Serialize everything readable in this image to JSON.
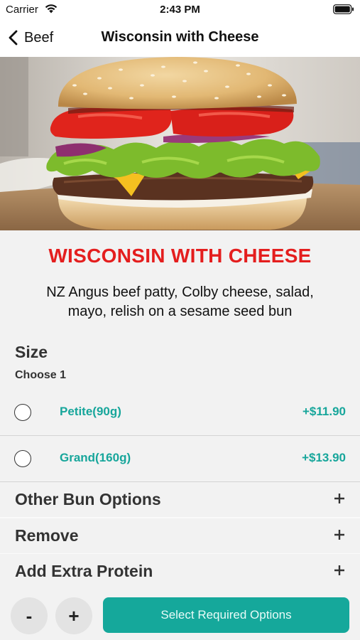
{
  "status_bar": {
    "carrier": "Carrier",
    "time": "2:43 PM",
    "icons": [
      "wifi-icon",
      "battery-icon"
    ]
  },
  "nav": {
    "back_label": "Beef",
    "back_icon": "chevron-left-icon",
    "title": "Wisconsin with Cheese"
  },
  "hero": {
    "image": "burger-photo"
  },
  "item": {
    "title": "WISCONSIN WITH CHEESE",
    "description": "NZ Angus beef patty, Colby cheese, salad, mayo, relish on a sesame seed bun"
  },
  "size": {
    "heading": "Size",
    "subheading": "Choose 1",
    "options": [
      {
        "name": "Petite(90g)",
        "price": "+$11.90",
        "selected": false
      },
      {
        "name": "Grand(160g)",
        "price": "+$13.90",
        "selected": false
      }
    ]
  },
  "sections": [
    {
      "label": "Other Bun Options",
      "icon": "plus-icon"
    },
    {
      "label": "Remove",
      "icon": "plus-icon"
    },
    {
      "label": "Add Extra Protein",
      "icon": "plus-icon"
    }
  ],
  "bottom": {
    "minus_label": "-",
    "plus_label": "+",
    "cta_label": "Select Required Options"
  },
  "colors": {
    "title_red": "#e41e1e",
    "accent_teal": "#15a89b",
    "option_text_teal": "#17a69b",
    "background": "#f2f2f2"
  }
}
